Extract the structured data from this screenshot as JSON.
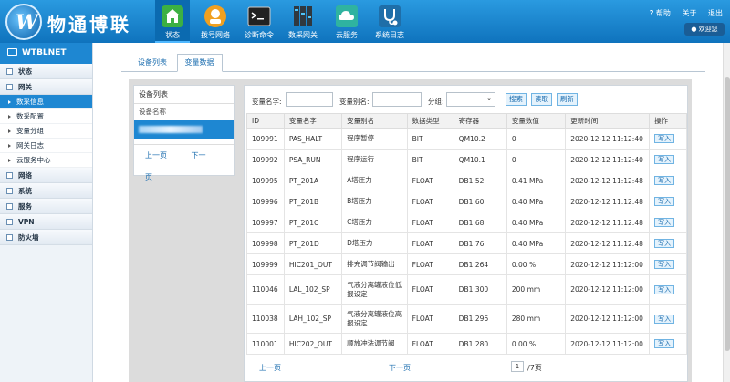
{
  "header": {
    "brand": "物通博联",
    "nav": [
      {
        "label": "状态",
        "icon": "home-icon",
        "active": true
      },
      {
        "label": "拨号网络",
        "icon": "dial-network-icon",
        "active": false
      },
      {
        "label": "诊断命令",
        "icon": "terminal-icon",
        "active": false
      },
      {
        "label": "数采网关",
        "icon": "data-gateway-icon",
        "active": false
      },
      {
        "label": "云服务",
        "icon": "cloud-icon",
        "active": false
      },
      {
        "label": "系统日志",
        "icon": "stethoscope-icon",
        "active": false
      }
    ],
    "help": "帮助",
    "about": "关于",
    "logout": "退出",
    "welcome": "欢迎您"
  },
  "sidebar": {
    "title": "WTBLNET",
    "groups_top": [
      {
        "label": "状态"
      },
      {
        "label": "网关"
      }
    ],
    "items": [
      {
        "label": "数采信息",
        "active": true
      },
      {
        "label": "数采配置",
        "active": false
      },
      {
        "label": "变量分组",
        "active": false
      },
      {
        "label": "网关日志",
        "active": false
      },
      {
        "label": "云服务中心",
        "active": false
      }
    ],
    "groups_bottom": [
      {
        "label": "网络"
      },
      {
        "label": "系统"
      },
      {
        "label": "服务"
      },
      {
        "label": "VPN"
      },
      {
        "label": "防火墙"
      }
    ]
  },
  "tabs": [
    {
      "label": "设备列表",
      "active": false
    },
    {
      "label": "变量数据",
      "active": true
    }
  ],
  "device_panel": {
    "title": "设备列表",
    "column": "设备名称",
    "prev": "上一页",
    "next": "下一页"
  },
  "filters": {
    "var_name_label": "变量名字:",
    "var_alias_label": "变量别名:",
    "group_label": "分组:",
    "search": "搜索",
    "read": "读取",
    "refresh": "刷新"
  },
  "table": {
    "headers": [
      "ID",
      "变量名字",
      "变量别名",
      "数据类型",
      "寄存器",
      "变量数值",
      "更新时间",
      "操作"
    ],
    "rows": [
      [
        "109991",
        "PAS_HALT",
        "程序暂停",
        "BIT",
        "QM10.2",
        "0",
        "2020-12-12 11:12:40",
        "写入"
      ],
      [
        "109992",
        "PSA_RUN",
        "程序运行",
        "BIT",
        "QM10.1",
        "0",
        "2020-12-12 11:12:40",
        "写入"
      ],
      [
        "109995",
        "PT_201A",
        "A塔压力",
        "FLOAT",
        "DB1:52",
        "0.41 MPa",
        "2020-12-12 11:12:48",
        "写入"
      ],
      [
        "109996",
        "PT_201B",
        "B塔压力",
        "FLOAT",
        "DB1:60",
        "0.40 MPa",
        "2020-12-12 11:12:48",
        "写入"
      ],
      [
        "109997",
        "PT_201C",
        "C塔压力",
        "FLOAT",
        "DB1:68",
        "0.40 MPa",
        "2020-12-12 11:12:48",
        "写入"
      ],
      [
        "109998",
        "PT_201D",
        "D塔压力",
        "FLOAT",
        "DB1:76",
        "0.40 MPa",
        "2020-12-12 11:12:48",
        "写入"
      ],
      [
        "109999",
        "HIC201_OUT",
        "排充调节阀输出",
        "FLOAT",
        "DB1:264",
        "0.00 %",
        "2020-12-12 11:12:00",
        "写入"
      ],
      [
        "110046",
        "LAL_102_SP",
        "气液分离罐液位低报设定",
        "FLOAT",
        "DB1:300",
        "200 mm",
        "2020-12-12 11:12:00",
        "写入"
      ],
      [
        "110038",
        "LAH_102_SP",
        "气液分离罐液位高报设定",
        "FLOAT",
        "DB1:296",
        "280 mm",
        "2020-12-12 11:12:00",
        "写入"
      ],
      [
        "110001",
        "HIC202_OUT",
        "顺放冲洗调节阀",
        "FLOAT",
        "DB1:280",
        "0.00 %",
        "2020-12-12 11:12:00",
        "写入"
      ]
    ]
  },
  "pager": {
    "prev": "上一页",
    "next": "下一页",
    "page": "1",
    "total": "/7页"
  }
}
